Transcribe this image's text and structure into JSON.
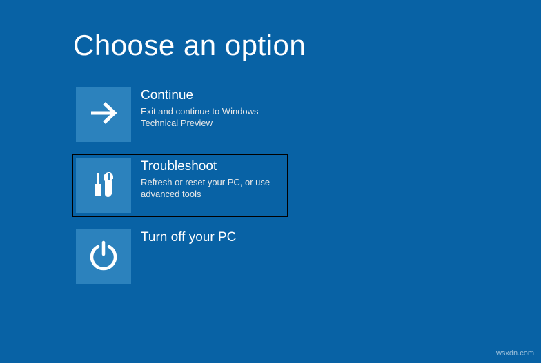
{
  "header": {
    "title": "Choose an option"
  },
  "options": {
    "continue": {
      "title": "Continue",
      "subtitle": "Exit and continue to Windows Technical Preview",
      "icon": "arrow-right-icon"
    },
    "troubleshoot": {
      "title": "Troubleshoot",
      "subtitle": "Refresh or reset your PC, or use advanced tools",
      "icon": "tools-icon"
    },
    "turnoff": {
      "title": "Turn off your PC",
      "subtitle": "",
      "icon": "power-icon"
    }
  },
  "watermark": "wsxdn.com",
  "colors": {
    "background": "#0862a5",
    "tile": "#2c82bd",
    "highlight": "#000000"
  }
}
